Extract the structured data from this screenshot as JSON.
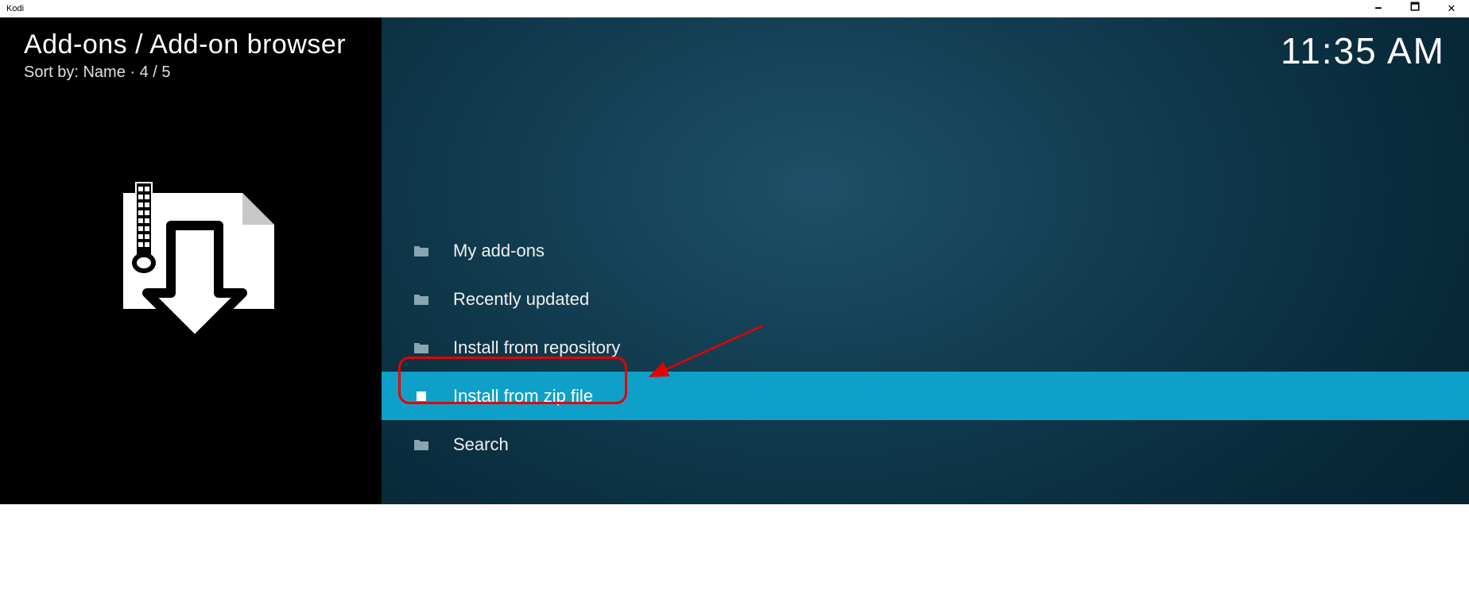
{
  "window": {
    "title": "Kodi"
  },
  "header": {
    "breadcrumb": "Add-ons / Add-on browser",
    "sort_label": "Sort by:",
    "sort_value": "Name",
    "counter": "4 / 5"
  },
  "clock": "11:35 AM",
  "menu": {
    "items": [
      {
        "label": "My add-ons",
        "icon_type": "folder",
        "selected": false
      },
      {
        "label": "Recently updated",
        "icon_type": "folder",
        "selected": false
      },
      {
        "label": "Install from repository",
        "icon_type": "folder",
        "selected": false
      },
      {
        "label": "Install from zip file",
        "icon_type": "square",
        "selected": true
      },
      {
        "label": "Search",
        "icon_type": "folder",
        "selected": false
      }
    ]
  },
  "icons": {
    "folder": "folder-icon",
    "square": "square-icon",
    "zip_file": "zip-download-icon"
  }
}
